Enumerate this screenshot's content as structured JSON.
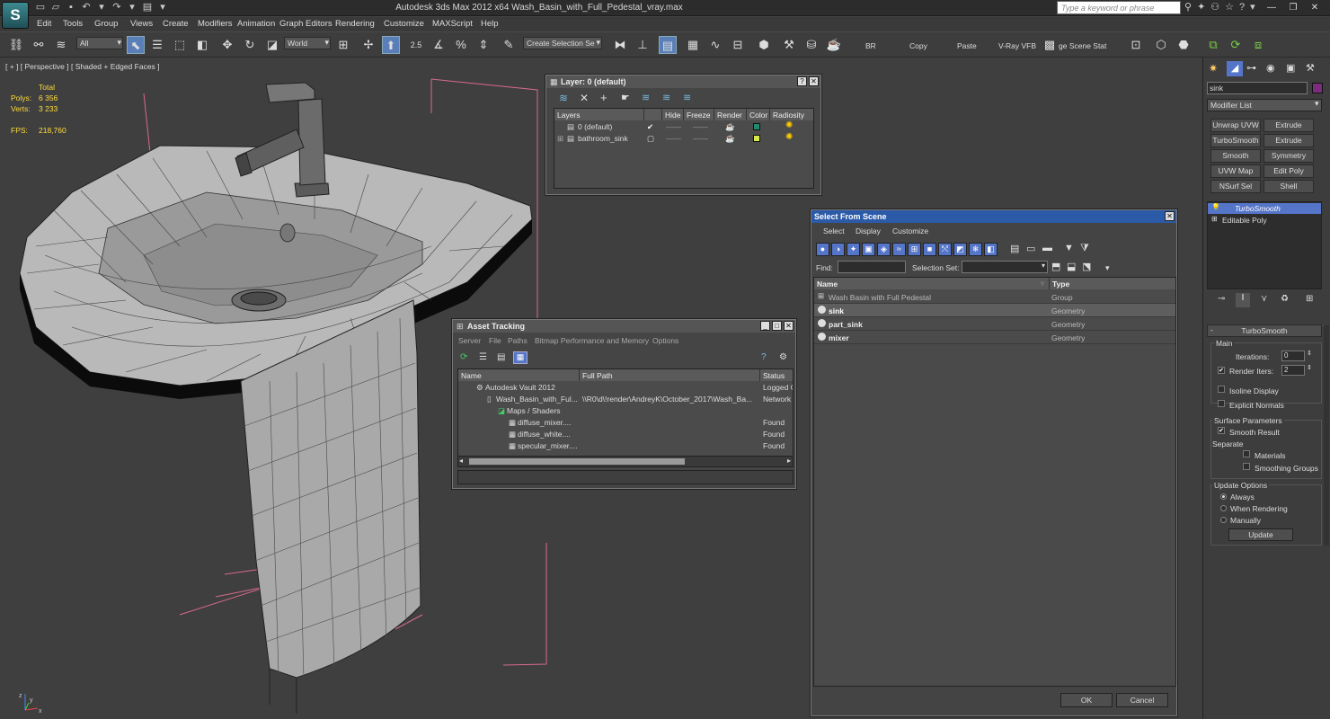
{
  "app": {
    "title": "Autodesk 3ds Max  2012 x64      Wash_Basin_with_Full_Pedestal_vray.max",
    "logo": "S",
    "search_placeholder": "Type a keyword or phrase"
  },
  "menu": [
    "Edit",
    "Tools",
    "Group",
    "Views",
    "Create",
    "Modifiers",
    "Animation",
    "Graph Editors",
    "Rendering",
    "Customize",
    "MAXScript",
    "Help"
  ],
  "toolbar": {
    "filter_value": "All",
    "coord_value": "World",
    "snap_value": "2.5",
    "selection_set_value": "Create Selection Se",
    "br_label": "BR",
    "copy_label": "Copy",
    "paste_label": "Paste",
    "vray_label": "V-Ray VFB",
    "scene_state_label": "ge Scene Stat"
  },
  "viewport": {
    "label": "[ + ] [ Perspective ] [ Shaded + Edged Faces ]",
    "stats": {
      "total_label": "Total",
      "polys_label": "Polys:",
      "polys_value": "6 356",
      "verts_label": "Verts:",
      "verts_value": "3 233",
      "fps_label": "FPS:",
      "fps_value": "218,760"
    },
    "axes": {
      "x": "x",
      "y": "y",
      "z": "z"
    }
  },
  "layer_panel": {
    "title": "Layer: 0 (default)",
    "headers": [
      "Layers",
      "Hide",
      "Freeze",
      "Render",
      "Color",
      "Radiosity"
    ],
    "rows": [
      {
        "name": "0 (default)",
        "color": "#1f8a6e"
      },
      {
        "name": "bathroom_sink",
        "color": "#d9e84a"
      }
    ]
  },
  "asset_tracking": {
    "title": "Asset Tracking",
    "menu": [
      "Server",
      "File",
      "Paths",
      "Bitmap Performance and Memory",
      "Options"
    ],
    "headers": [
      "Name",
      "Full Path",
      "Status"
    ],
    "rows": [
      {
        "name": "Autodesk Vault 2012",
        "path": "",
        "status": "Logged O"
      },
      {
        "name": "Wash_Basin_with_Ful...",
        "path": "\\\\R0\\d\\!render\\AndreyK\\October_2017\\Wash_Ba...",
        "status": "Network"
      },
      {
        "name": "Maps / Shaders",
        "path": "",
        "status": ""
      },
      {
        "name": "diffuse_mixer....",
        "path": "",
        "status": "Found"
      },
      {
        "name": "diffuse_white....",
        "path": "",
        "status": "Found"
      },
      {
        "name": "specular_mixer....",
        "path": "",
        "status": "Found"
      }
    ]
  },
  "select_scene": {
    "title": "Select From Scene",
    "menu": [
      "Select",
      "Display",
      "Customize"
    ],
    "find_label": "Find:",
    "selection_set_label": "Selection Set:",
    "headers": [
      "Name",
      "Type"
    ],
    "rows": [
      {
        "name": "Wash Basin with Full Pedestal",
        "type": "Group"
      },
      {
        "name": "sink",
        "type": "Geometry"
      },
      {
        "name": "part_sink",
        "type": "Geometry"
      },
      {
        "name": "mixer",
        "type": "Geometry"
      }
    ],
    "ok_label": "OK",
    "cancel_label": "Cancel"
  },
  "command_panel": {
    "object_name": "sink",
    "object_color": "#7a2d7a",
    "modifier_list": "Modifier List",
    "modifier_buttons": [
      "Unwrap UVW",
      "Extrude",
      "TurboSmooth",
      "Extrude",
      "Smooth",
      "Symmetry",
      "UVW Map",
      "Edit Poly",
      "NSurf Sel",
      "Shell"
    ],
    "stack": [
      "TurboSmooth",
      "Editable Poly"
    ],
    "rollout_title": "TurboSmooth",
    "main_label": "Main",
    "iterations_label": "Iterations:",
    "iterations_value": "0",
    "render_iters_label": "Render Iters:",
    "render_iters_value": "2",
    "isoline_label": "Isoline Display",
    "explicit_normals_label": "Explicit Normals",
    "surface_params_label": "Surface Parameters",
    "smooth_result_label": "Smooth Result",
    "separate_label": "Separate",
    "materials_label": "Materials",
    "smoothing_groups_label": "Smoothing Groups",
    "update_options_label": "Update Options",
    "always_label": "Always",
    "when_rendering_label": "When Rendering",
    "manually_label": "Manually",
    "update_label": "Update"
  }
}
